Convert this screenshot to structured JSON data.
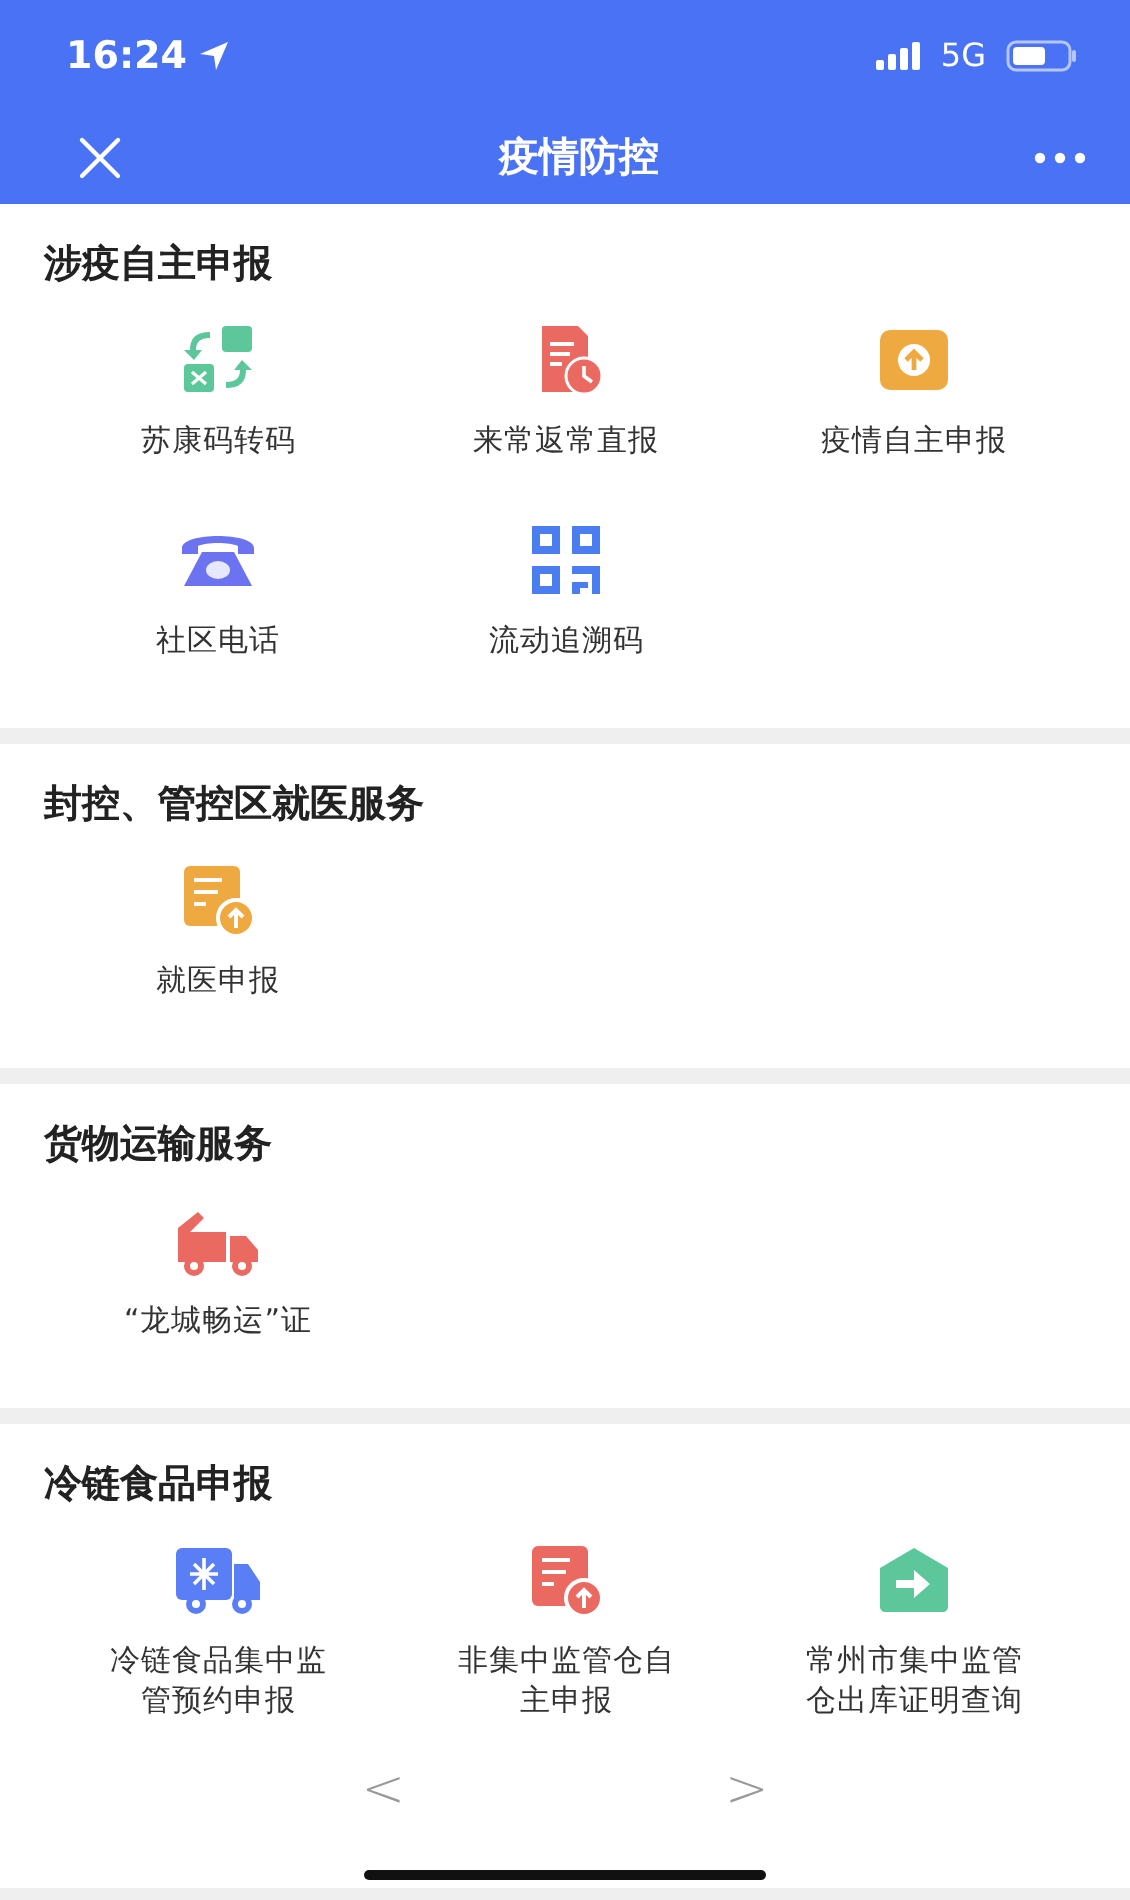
{
  "status_bar": {
    "time": "16:24",
    "network": "5G"
  },
  "nav_bar": {
    "title": "疫情防控"
  },
  "sections": [
    {
      "title": "涉疫自主申报",
      "items": [
        {
          "label": "苏康码转码",
          "kind": "swap",
          "color": "#5cc79a"
        },
        {
          "label": "来常返常直报",
          "kind": "doc-clock",
          "color": "#ea6a62"
        },
        {
          "label": "疫情自主申报",
          "kind": "upload-box",
          "color": "#eeaa40"
        },
        {
          "label": "社区电话",
          "kind": "phone",
          "color": "#6c73f0"
        },
        {
          "label": "流动追溯码",
          "kind": "qr",
          "color": "#4a7ef0"
        }
      ]
    },
    {
      "title": "封控、管控区就医服务",
      "items": [
        {
          "label": "就医申报",
          "kind": "doc-upload",
          "color": "#eeaa40"
        }
      ]
    },
    {
      "title": "货物运输服务",
      "items": [
        {
          "label": "“龙城畅运”证",
          "kind": "truck",
          "color": "#ea6a62"
        }
      ]
    },
    {
      "title": "冷链食品申报",
      "items": [
        {
          "label": "冷链食品集中监管预约申报",
          "kind": "snow-truck",
          "color": "#5a7ef5"
        },
        {
          "label": "非集中监管仓自主申报",
          "kind": "doc-upload",
          "color": "#ea6a62"
        },
        {
          "label": "常州市集中监管仓出库证明查询",
          "kind": "house-arrow",
          "color": "#5cc79a"
        }
      ]
    }
  ],
  "pager": {
    "prev": "<",
    "next": ">"
  }
}
